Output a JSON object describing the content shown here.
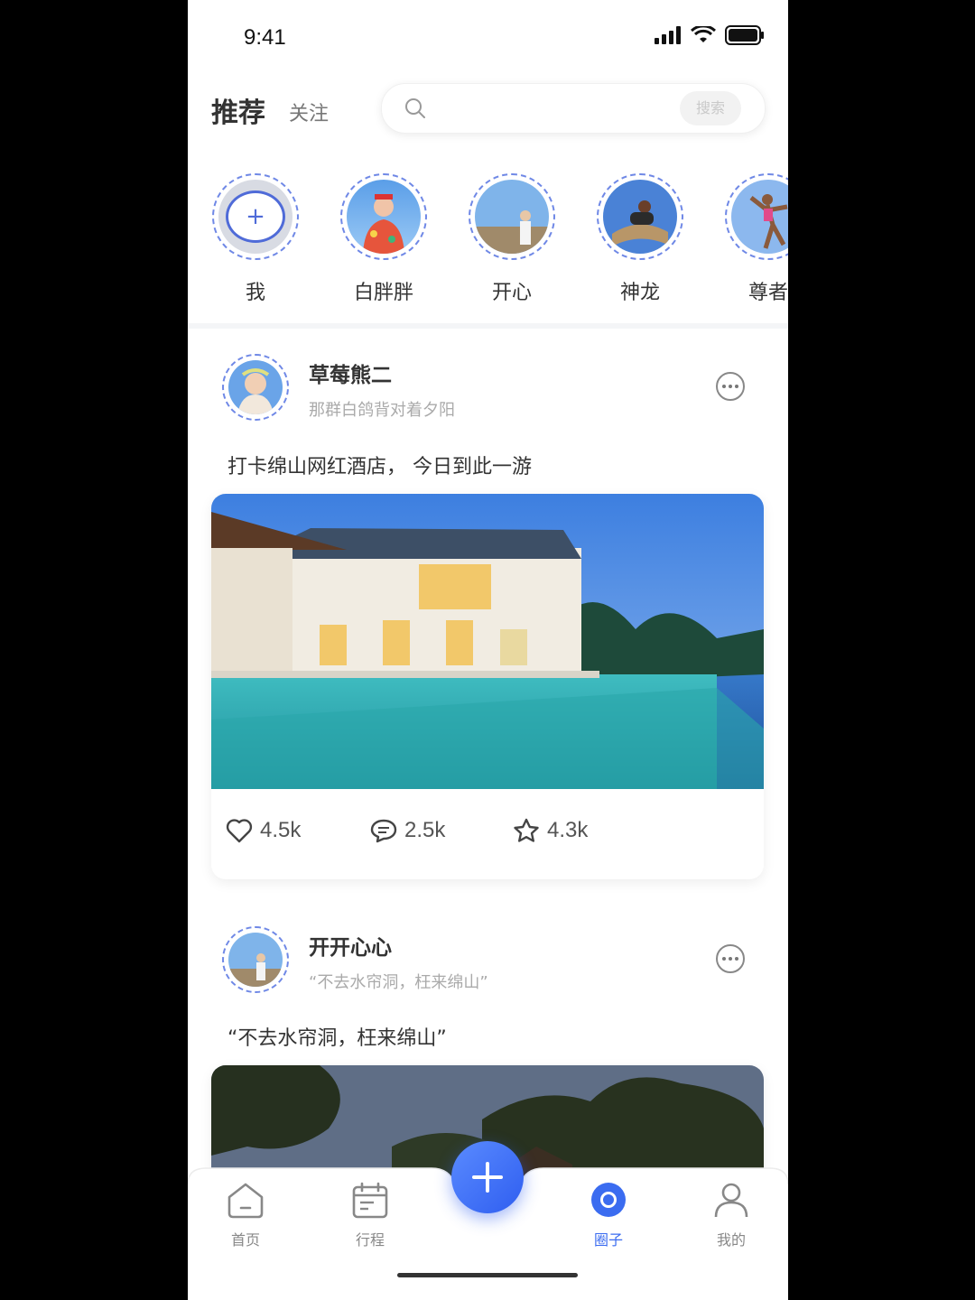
{
  "status_bar": {
    "time": "9:41"
  },
  "header": {
    "tab_active": "推荐",
    "tab_inactive": "关注",
    "search_button": "搜索"
  },
  "stories": [
    {
      "label": "我",
      "type": "add"
    },
    {
      "label": "白胖胖"
    },
    {
      "label": "开心"
    },
    {
      "label": "神龙"
    },
    {
      "label": "尊者"
    }
  ],
  "posts": [
    {
      "name": "草莓熊二",
      "subtitle": "那群白鸽背对着夕阳",
      "text": "打卡绵山网红酒店， 今日到此一游",
      "likes": "4.5k",
      "comments": "2.5k",
      "stars": "4.3k"
    },
    {
      "name": "开开心心",
      "subtitle": "“不去水帘洞，枉来绵山”",
      "text": "“不去水帘洞，枉来绵山”"
    }
  ],
  "bottom_nav": {
    "items": [
      {
        "label": "首页",
        "icon": "home-icon"
      },
      {
        "label": "行程",
        "icon": "calendar-icon"
      },
      {
        "label": "圈子",
        "icon": "circle-icon",
        "active": true
      },
      {
        "label": "我的",
        "icon": "user-icon"
      }
    ]
  },
  "colors": {
    "accent": "#3b6cf0",
    "ring": "#6f88e6"
  }
}
